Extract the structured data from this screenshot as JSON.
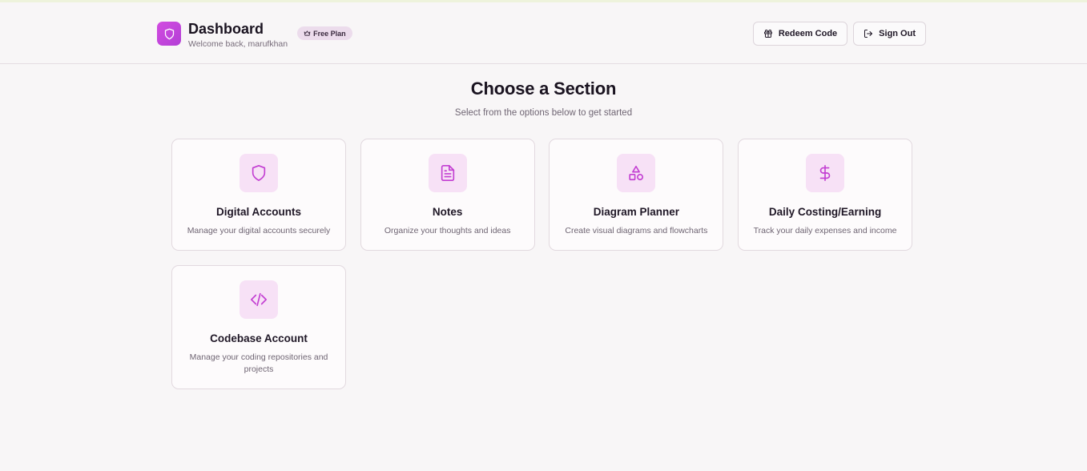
{
  "header": {
    "title": "Dashboard",
    "subtitle": "Welcome back, marufkhan",
    "plan_badge": "Free Plan",
    "redeem_label": "Redeem Code",
    "signout_label": "Sign Out",
    "accent": "#c944dc"
  },
  "main": {
    "title": "Choose a Section",
    "subtitle": "Select from the options below to get started",
    "cards": [
      {
        "title": "Digital Accounts",
        "desc": "Manage your digital accounts securely",
        "icon": "shield-icon"
      },
      {
        "title": "Notes",
        "desc": "Organize your thoughts and ideas",
        "icon": "file-text-icon"
      },
      {
        "title": "Diagram Planner",
        "desc": "Create visual diagrams and flowcharts",
        "icon": "shapes-icon"
      },
      {
        "title": "Daily Costing/Earning",
        "desc": "Track your daily expenses and income",
        "icon": "dollar-icon"
      },
      {
        "title": "Codebase Account",
        "desc": "Manage your coding repositories and projects",
        "icon": "code-icon"
      }
    ]
  }
}
